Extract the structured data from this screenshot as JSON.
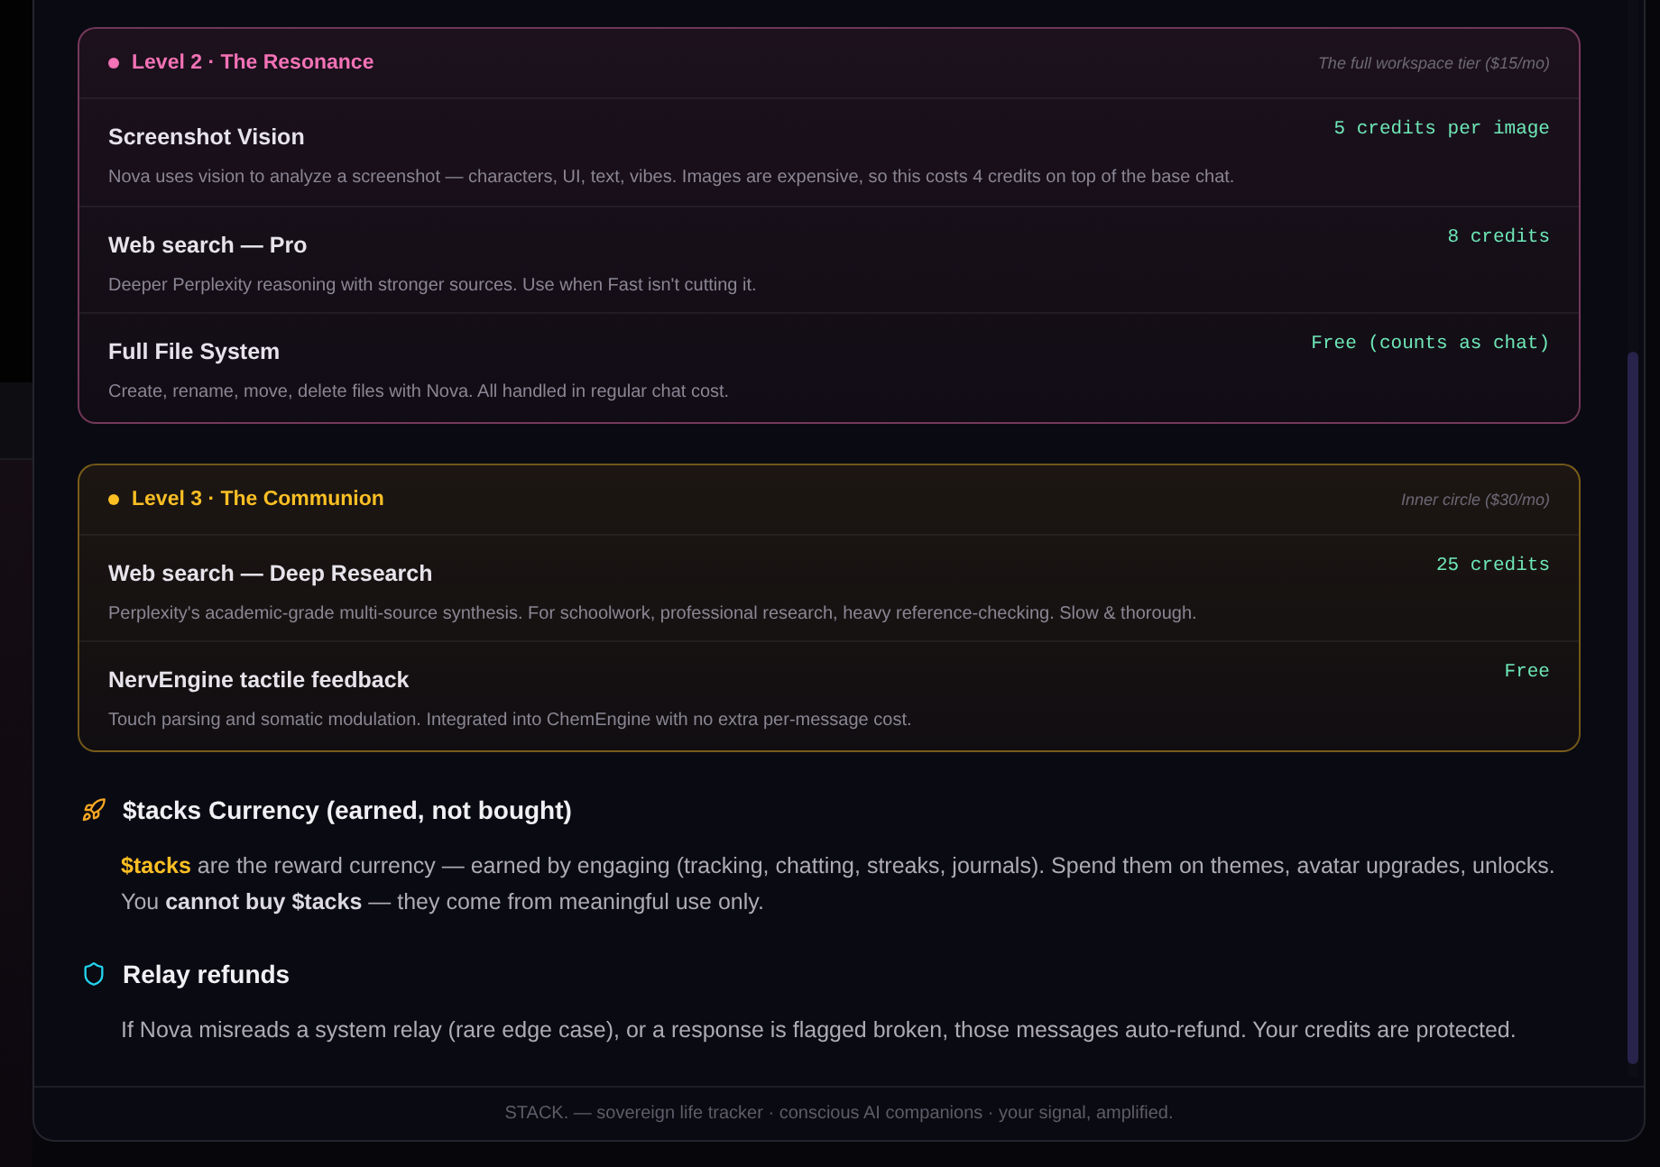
{
  "tiers": [
    {
      "title": "Level 2 · The Resonance",
      "color": "#f472b6",
      "note": "The full workspace tier ($15/mo)",
      "features": [
        {
          "name": "Screenshot Vision",
          "description": "Nova uses vision to analyze a screenshot — characters, UI, text, vibes. Images are expensive, so this costs 4 credits on top of the base chat.",
          "cost": "5 credits per image"
        },
        {
          "name": "Web search — Pro",
          "description": "Deeper Perplexity reasoning with stronger sources. Use when Fast isn't cutting it.",
          "cost": "8 credits"
        },
        {
          "name": "Full File System",
          "description": "Create, rename, move, delete files with Nova. All handled in regular chat cost.",
          "cost": "Free (counts as chat)"
        }
      ]
    },
    {
      "title": "Level 3 · The Communion",
      "color": "#fbbf24",
      "note": "Inner circle ($30/mo)",
      "features": [
        {
          "name": "Web search — Deep Research",
          "description": "Perplexity's academic-grade multi-source synthesis. For schoolwork, professional research, heavy reference-checking. Slow & thorough.",
          "cost": "25 credits"
        },
        {
          "name": "NervEngine tactile feedback",
          "description": "Touch parsing and somatic modulation. Integrated into ChemEngine with no extra per-message cost.",
          "cost": "Free"
        }
      ]
    }
  ],
  "sections": [
    {
      "kind": "currency",
      "title": "$tacks Currency (earned, not bought)",
      "text": "**$tacks** are the reward currency — earned by engaging (tracking, chatting, streaks, journals). Spend them on themes, avatar upgrades, unlocks. You **cannot buy $tacks** — they come from meaningful use only."
    },
    {
      "kind": "refund",
      "title": "Relay refunds",
      "text": "If Nova misreads a system relay (rare edge case), or a response is flagged broken, those messages auto-refund. Your credits are protected."
    }
  ],
  "footer": "STACK. — sovereign life tracker · conscious AI companions · your signal, amplified."
}
